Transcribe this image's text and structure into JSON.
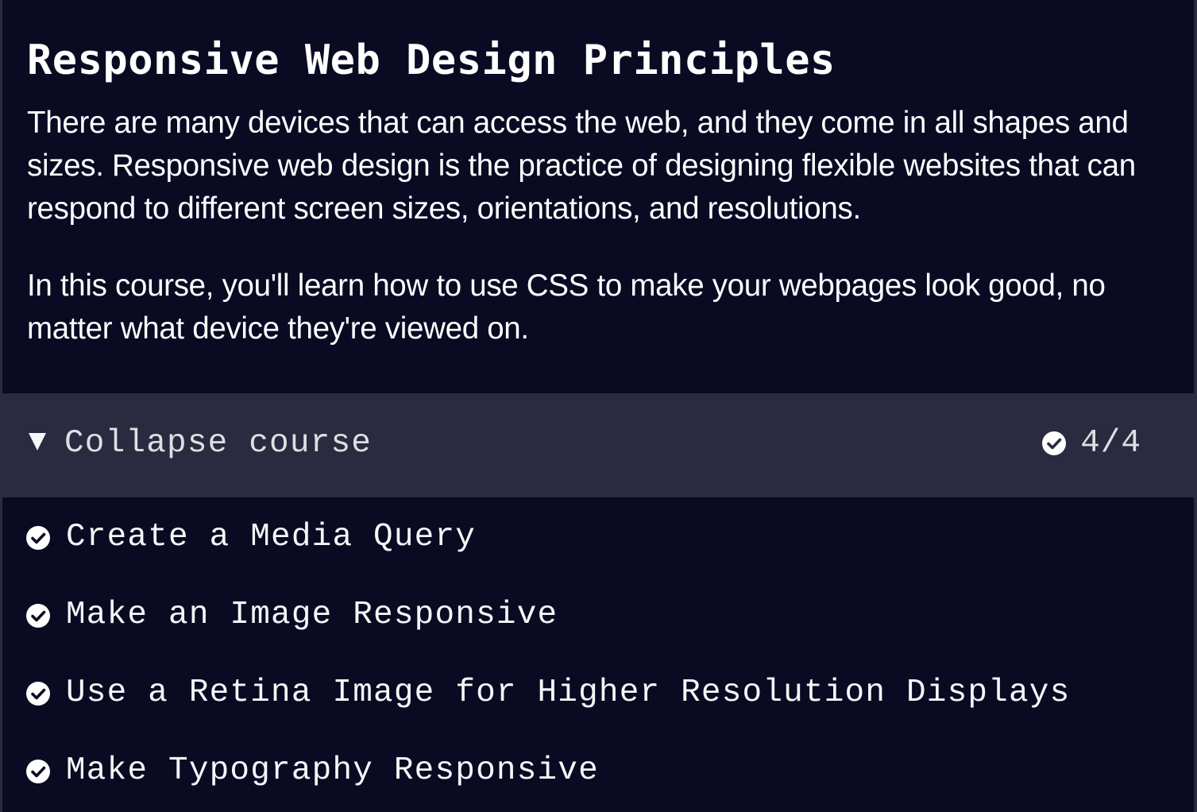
{
  "colors": {
    "background": "#0a0a23",
    "toggle_background": "#2a2a40",
    "text": "#ffffff",
    "check": "#ffffff"
  },
  "header": {
    "title": "Responsive Web Design Principles"
  },
  "intro": {
    "paragraphs": [
      "There are many devices that can access the web, and they come in all shapes and sizes. Responsive web design is the practice of designing flexible websites that can respond to different screen sizes, orientations, and resolutions.",
      "In this course, you'll learn how to use CSS to make your webpages look good, no matter what device they're viewed on."
    ]
  },
  "course_toggle": {
    "label": "Collapse course",
    "icon": "caret-down-icon",
    "progress": "4/4",
    "progress_icon": "check-circle-icon"
  },
  "lessons": [
    {
      "label": "Create a Media Query",
      "completed": true,
      "icon": "check-circle-icon"
    },
    {
      "label": "Make an Image Responsive",
      "completed": true,
      "icon": "check-circle-icon"
    },
    {
      "label": "Use a Retina Image for Higher Resolution Displays",
      "completed": true,
      "icon": "check-circle-icon"
    },
    {
      "label": "Make Typography Responsive",
      "completed": true,
      "icon": "check-circle-icon"
    }
  ]
}
